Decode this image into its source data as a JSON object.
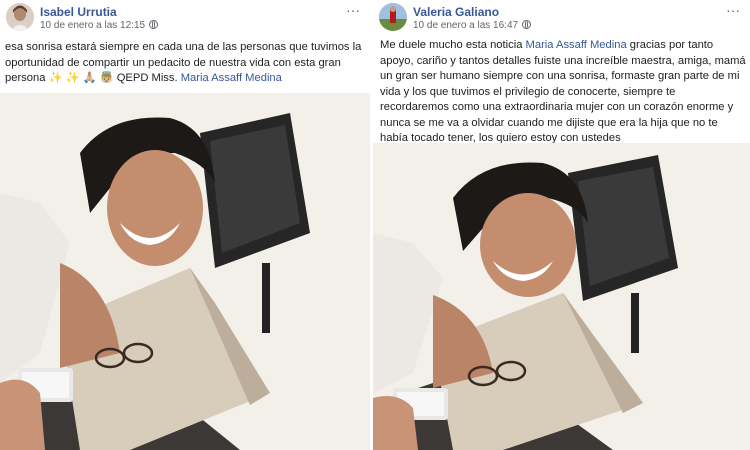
{
  "posts": [
    {
      "author": "Isabel Urrutia",
      "date": "10 de enero a las 12:15",
      "more": "···",
      "text": "esa sonrisa estará siempre en cada una de las personas que tuvimos la oportunidad de compartir un pedacito de nuestra vida con esta gran persona ✨ ✨ 🙏🏼 👼🏼 QEPD Miss.",
      "mention": "Maria Assaff Medina"
    },
    {
      "author": "Valeria Galiano",
      "date": "10 de enero a las 16:47",
      "more": "···",
      "text_before": "Me duele mucho esta noticia",
      "mention": "Maria Assaff Medina",
      "text_after": "gracias por tanto apoyo, cariño y tantos detalles fuiste una increíble maestra, amiga, mamá un gran ser humano siempre con una sonrisa, formaste gran parte de mi vida y los que tuvimos el privilegio de conocerte, siempre te recordaremos como una extraordinaria mujer con un corazón enorme y nunca se me va a olvidar cuando me dijiste que era la hija que no te había tocado tener, los quiero estoy con ustedes"
    }
  ],
  "colors": {
    "name": "#385898",
    "meta": "#606770",
    "text": "#1c1e21",
    "mention": "#385898"
  },
  "icons": [
    "globe-icon",
    "more-options-icon"
  ]
}
